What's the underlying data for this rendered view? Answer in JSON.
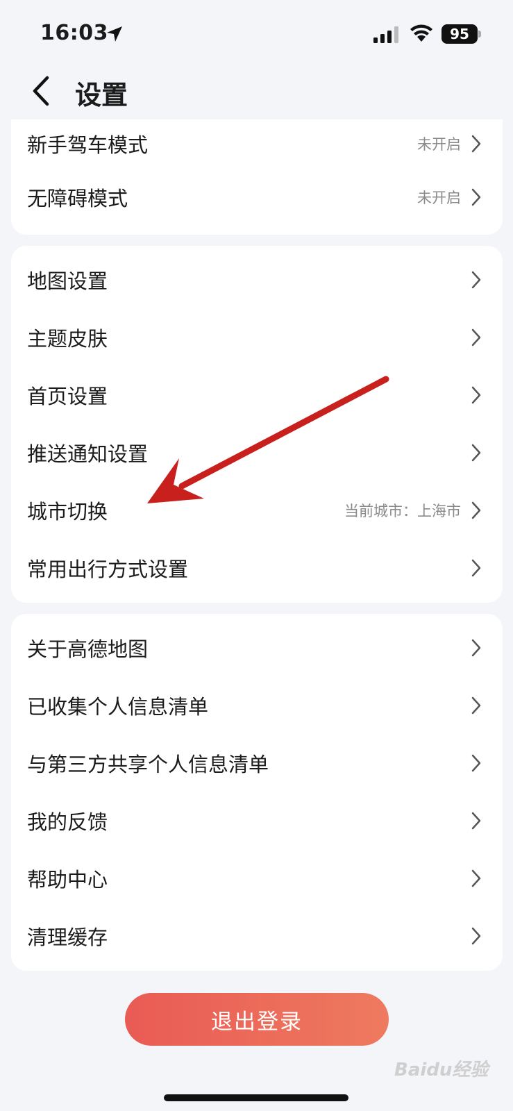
{
  "status_bar": {
    "time": "16:03",
    "battery": "95"
  },
  "header": {
    "title": "设置"
  },
  "group1": [
    {
      "label": "新手驾车模式",
      "value": "未开启"
    },
    {
      "label": "无障碍模式",
      "value": "未开启"
    }
  ],
  "group2": [
    {
      "label": "地图设置",
      "value": ""
    },
    {
      "label": "主题皮肤",
      "value": ""
    },
    {
      "label": "首页设置",
      "value": ""
    },
    {
      "label": "推送通知设置",
      "value": ""
    },
    {
      "label": "城市切换",
      "value": "当前城市：上海市"
    },
    {
      "label": "常用出行方式设置",
      "value": ""
    }
  ],
  "group3": [
    {
      "label": "关于高德地图",
      "value": ""
    },
    {
      "label": "已收集个人信息清单",
      "value": ""
    },
    {
      "label": "与第三方共享个人信息清单",
      "value": ""
    },
    {
      "label": "我的反馈",
      "value": ""
    },
    {
      "label": "帮助中心",
      "value": ""
    },
    {
      "label": "清理缓存",
      "value": ""
    }
  ],
  "logout_label": "退出登录",
  "watermark": "Baidu经验",
  "colors": {
    "background": "#f4f5f9",
    "logout_gradient_start": "#e95b55",
    "logout_gradient_end": "#ee7a5f",
    "annotation_arrow": "#c8201c"
  }
}
